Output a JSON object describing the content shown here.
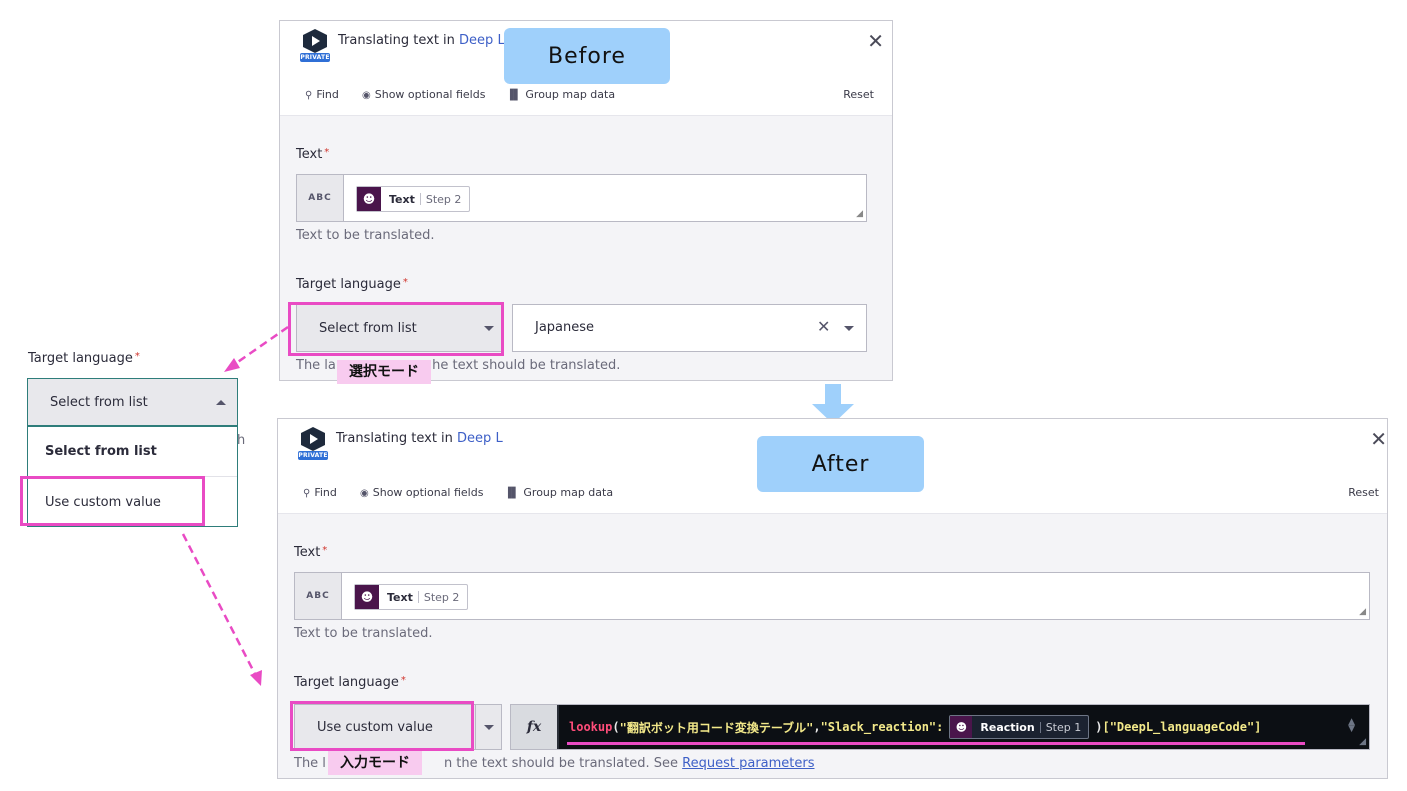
{
  "app": {
    "private_badge": "PRIVATE",
    "title_prefix": "Translating text in",
    "title_link": "Deep L"
  },
  "toolbar": {
    "find": "Find",
    "show_optional": "Show optional fields",
    "group_map": "Group map data",
    "reset": "Reset"
  },
  "fields": {
    "text_label": "Text",
    "required_mark": "*",
    "abc": "ABC",
    "text_pill_name": "Text",
    "text_pill_step": "Step 2",
    "text_help": "Text to be translated.",
    "target_label": "Target language"
  },
  "before": {
    "callout": "Before",
    "mode_select": "Select from list",
    "value": "Japanese",
    "help_left": "The lan",
    "help_right": "he text should be translated.",
    "tag": "選択モード"
  },
  "dropdown": {
    "label": "Target language",
    "selected": "Select from list",
    "options": [
      "Select from list",
      "Use custom value"
    ],
    "partial_right": "h"
  },
  "after": {
    "callout": "After",
    "mode_select": "Use custom value",
    "help_left": "The l",
    "help_right": "n the text should be translated. See",
    "help_link": "Request parameters",
    "tag": "入力モード",
    "fx": "fx",
    "code_fn": "lookup",
    "code_open": "(",
    "code_arg1": "\"翻訳ボット用コード変換テーブル\"",
    "code_comma": ", ",
    "code_arg2": "\"Slack_reaction\":",
    "pill_name": "Reaction",
    "pill_step": "Step 1",
    "code_close": ")",
    "code_index": "[\"DeepL_languageCode\"]"
  },
  "colors": {
    "highlight": "#e94bc4",
    "callout_bg": "#9fd0fb",
    "link": "#3d5fc7",
    "slack": "#4a154b"
  }
}
